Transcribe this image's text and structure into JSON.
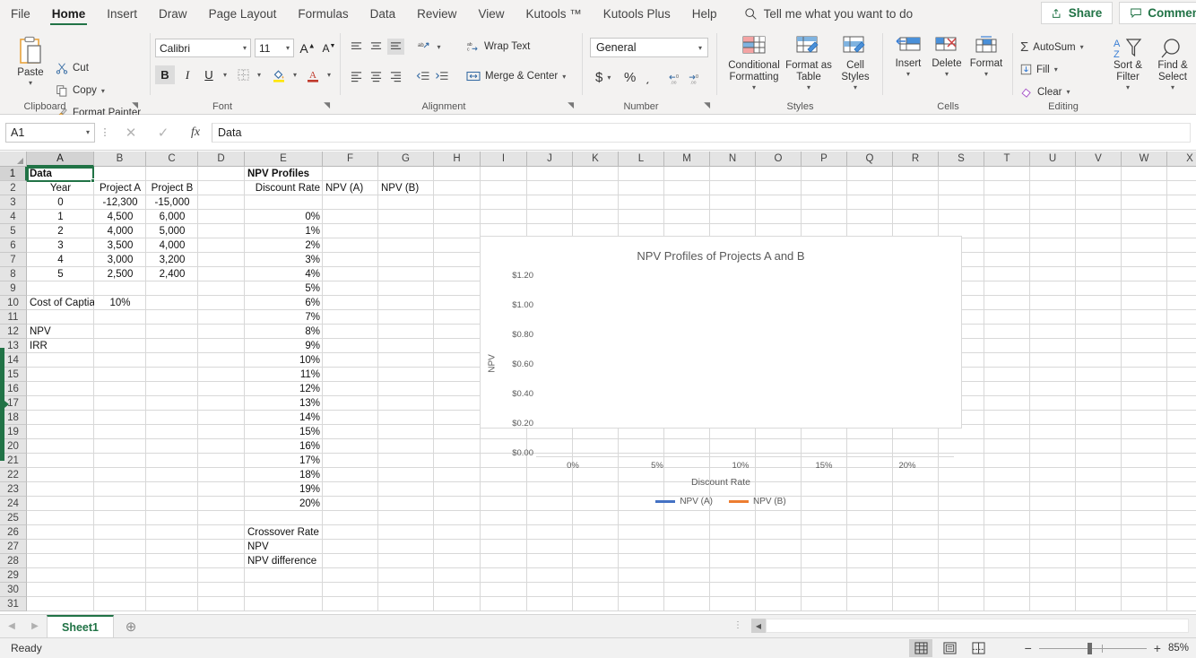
{
  "ribbon": {
    "tabs": [
      {
        "label": "File",
        "active": false
      },
      {
        "label": "Home",
        "active": true
      },
      {
        "label": "Insert",
        "active": false
      },
      {
        "label": "Draw",
        "active": false
      },
      {
        "label": "Page Layout",
        "active": false
      },
      {
        "label": "Formulas",
        "active": false
      },
      {
        "label": "Data",
        "active": false
      },
      {
        "label": "Review",
        "active": false
      },
      {
        "label": "View",
        "active": false
      },
      {
        "label": "Kutools ™",
        "active": false
      },
      {
        "label": "Kutools Plus",
        "active": false
      },
      {
        "label": "Help",
        "active": false
      }
    ],
    "tellme": "Tell me what you want to do",
    "share_label": "Share",
    "comments_label": "Comments",
    "groups": {
      "clipboard": {
        "label": "Clipboard",
        "paste": "Paste",
        "cut": "Cut",
        "copy": "Copy",
        "format_painter": "Format Painter"
      },
      "font": {
        "label": "Font",
        "family": "Calibri",
        "size": "11",
        "grow": "A",
        "shrink": "A",
        "bold": "B",
        "italic": "I",
        "underline": "U"
      },
      "alignment": {
        "label": "Alignment",
        "wrap_text": "Wrap Text",
        "merge_center": "Merge & Center"
      },
      "number": {
        "label": "Number",
        "format": "General",
        "currency": "$",
        "percent": "%",
        "comma": "͵"
      },
      "styles": {
        "label": "Styles",
        "conditional_formatting": "Conditional Formatting",
        "format_as_table": "Format as Table",
        "cell_styles": "Cell Styles"
      },
      "cells": {
        "label": "Cells",
        "insert": "Insert",
        "delete": "Delete",
        "format": "Format"
      },
      "editing": {
        "label": "Editing",
        "autosum": "AutoSum",
        "fill": "Fill",
        "clear": "Clear",
        "sort_filter": "Sort & Filter",
        "find_select": "Find & Select"
      }
    }
  },
  "formula_bar": {
    "name_box": "A1",
    "value": "Data"
  },
  "grid": {
    "columns": [
      "A",
      "B",
      "C",
      "D",
      "E",
      "F",
      "G",
      "H",
      "I",
      "J",
      "K",
      "L",
      "M",
      "N",
      "O",
      "P",
      "Q",
      "R",
      "S",
      "T",
      "U",
      "V",
      "W",
      "X"
    ],
    "selected_column": "A",
    "selected_row": 1,
    "rows": [
      1,
      2,
      3,
      4,
      5,
      6,
      7,
      8,
      9,
      10,
      11,
      12,
      13,
      14,
      15,
      16,
      17,
      18,
      19,
      20,
      21,
      22,
      23,
      24,
      25,
      26,
      27,
      28,
      29,
      30,
      31
    ],
    "cells": [
      {
        "row": 1,
        "col": "A",
        "text": "Data",
        "align": "left",
        "bold": true
      },
      {
        "row": 1,
        "col": "E",
        "text": "NPV Profiles",
        "align": "left",
        "bold": true
      },
      {
        "row": 2,
        "col": "A",
        "text": "Year",
        "align": "center"
      },
      {
        "row": 2,
        "col": "B",
        "text": "Project A",
        "align": "center"
      },
      {
        "row": 2,
        "col": "C",
        "text": "Project B",
        "align": "center"
      },
      {
        "row": 2,
        "col": "E",
        "text": "Discount Rate",
        "align": "right"
      },
      {
        "row": 2,
        "col": "F",
        "text": "NPV (A)",
        "align": "left"
      },
      {
        "row": 2,
        "col": "G",
        "text": "NPV (B)",
        "align": "left"
      },
      {
        "row": 3,
        "col": "A",
        "text": "0",
        "align": "center"
      },
      {
        "row": 3,
        "col": "B",
        "text": "-12,300",
        "align": "center"
      },
      {
        "row": 3,
        "col": "C",
        "text": "-15,000",
        "align": "center"
      },
      {
        "row": 4,
        "col": "A",
        "text": "1",
        "align": "center"
      },
      {
        "row": 4,
        "col": "B",
        "text": "4,500",
        "align": "center"
      },
      {
        "row": 4,
        "col": "C",
        "text": "6,000",
        "align": "center"
      },
      {
        "row": 4,
        "col": "E",
        "text": "0%",
        "align": "right"
      },
      {
        "row": 5,
        "col": "A",
        "text": "2",
        "align": "center"
      },
      {
        "row": 5,
        "col": "B",
        "text": "4,000",
        "align": "center"
      },
      {
        "row": 5,
        "col": "C",
        "text": "5,000",
        "align": "center"
      },
      {
        "row": 5,
        "col": "E",
        "text": "1%",
        "align": "right"
      },
      {
        "row": 6,
        "col": "A",
        "text": "3",
        "align": "center"
      },
      {
        "row": 6,
        "col": "B",
        "text": "3,500",
        "align": "center"
      },
      {
        "row": 6,
        "col": "C",
        "text": "4,000",
        "align": "center"
      },
      {
        "row": 6,
        "col": "E",
        "text": "2%",
        "align": "right"
      },
      {
        "row": 7,
        "col": "A",
        "text": "4",
        "align": "center"
      },
      {
        "row": 7,
        "col": "B",
        "text": "3,000",
        "align": "center"
      },
      {
        "row": 7,
        "col": "C",
        "text": "3,200",
        "align": "center"
      },
      {
        "row": 7,
        "col": "E",
        "text": "3%",
        "align": "right"
      },
      {
        "row": 8,
        "col": "A",
        "text": "5",
        "align": "center"
      },
      {
        "row": 8,
        "col": "B",
        "text": "2,500",
        "align": "center"
      },
      {
        "row": 8,
        "col": "C",
        "text": "2,400",
        "align": "center"
      },
      {
        "row": 8,
        "col": "E",
        "text": "4%",
        "align": "right"
      },
      {
        "row": 9,
        "col": "E",
        "text": "5%",
        "align": "right"
      },
      {
        "row": 10,
        "col": "A",
        "text": "Cost of Captia",
        "align": "left"
      },
      {
        "row": 10,
        "col": "B",
        "text": "10%",
        "align": "center"
      },
      {
        "row": 10,
        "col": "E",
        "text": "6%",
        "align": "right"
      },
      {
        "row": 11,
        "col": "E",
        "text": "7%",
        "align": "right"
      },
      {
        "row": 12,
        "col": "A",
        "text": "NPV",
        "align": "left"
      },
      {
        "row": 12,
        "col": "E",
        "text": "8%",
        "align": "right"
      },
      {
        "row": 13,
        "col": "A",
        "text": "IRR",
        "align": "left"
      },
      {
        "row": 13,
        "col": "E",
        "text": "9%",
        "align": "right"
      },
      {
        "row": 14,
        "col": "E",
        "text": "10%",
        "align": "right"
      },
      {
        "row": 15,
        "col": "E",
        "text": "11%",
        "align": "right"
      },
      {
        "row": 16,
        "col": "E",
        "text": "12%",
        "align": "right"
      },
      {
        "row": 17,
        "col": "E",
        "text": "13%",
        "align": "right"
      },
      {
        "row": 18,
        "col": "E",
        "text": "14%",
        "align": "right"
      },
      {
        "row": 19,
        "col": "E",
        "text": "15%",
        "align": "right"
      },
      {
        "row": 20,
        "col": "E",
        "text": "16%",
        "align": "right"
      },
      {
        "row": 21,
        "col": "E",
        "text": "17%",
        "align": "right"
      },
      {
        "row": 22,
        "col": "E",
        "text": "18%",
        "align": "right"
      },
      {
        "row": 23,
        "col": "E",
        "text": "19%",
        "align": "right"
      },
      {
        "row": 24,
        "col": "E",
        "text": "20%",
        "align": "right"
      },
      {
        "row": 26,
        "col": "E",
        "text": "Crossover Rate",
        "align": "left"
      },
      {
        "row": 27,
        "col": "E",
        "text": "NPV",
        "align": "left"
      },
      {
        "row": 28,
        "col": "E",
        "text": "NPV difference",
        "align": "left"
      }
    ]
  },
  "chart_data": {
    "type": "line",
    "title": "NPV Profiles of Projects A and B",
    "xlabel": "Discount Rate",
    "ylabel": "NPV",
    "x_ticks": [
      "0%",
      "5%",
      "10%",
      "15%",
      "20%"
    ],
    "y_ticks": [
      "$0.00",
      "$0.20",
      "$0.40",
      "$0.60",
      "$0.80",
      "$1.00",
      "$1.20"
    ],
    "ylim": [
      0,
      1.2
    ],
    "grid": false,
    "legend_position": "bottom",
    "series": [
      {
        "name": "NPV (A)",
        "color": "#4472c4",
        "values": []
      },
      {
        "name": "NPV (B)",
        "color": "#ed7d31",
        "values": []
      }
    ]
  },
  "sheet_tabs": {
    "tabs": [
      "Sheet1"
    ],
    "active": "Sheet1"
  },
  "status_bar": {
    "text": "Ready",
    "zoom": "85%"
  }
}
